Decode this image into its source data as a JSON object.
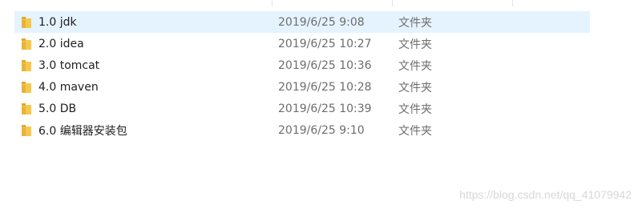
{
  "folders": [
    {
      "name": "1.0 jdk",
      "date": "2019/6/25 9:08",
      "type": "文件夹",
      "selected": true,
      "icon": "folder-icon"
    },
    {
      "name": "2.0 idea",
      "date": "2019/6/25 10:27",
      "type": "文件夹",
      "selected": false,
      "icon": "folder-icon"
    },
    {
      "name": "3.0 tomcat",
      "date": "2019/6/25 10:36",
      "type": "文件夹",
      "selected": false,
      "icon": "folder-icon"
    },
    {
      "name": "4.0 maven",
      "date": "2019/6/25 10:28",
      "type": "文件夹",
      "selected": false,
      "icon": "folder-icon"
    },
    {
      "name": "5.0 DB",
      "date": "2019/6/25 10:39",
      "type": "文件夹",
      "selected": false,
      "icon": "folder-icon"
    },
    {
      "name": "6.0 编辑器安装包",
      "date": "2019/6/25 9:10",
      "type": "文件夹",
      "selected": false,
      "icon": "folder-icon"
    }
  ],
  "watermark": "https://blog.csdn.net/qq_41079942",
  "colors": {
    "selected_row": "#e5f3ff",
    "folder": "#f5c84c",
    "folder_dark": "#e0a82e"
  }
}
